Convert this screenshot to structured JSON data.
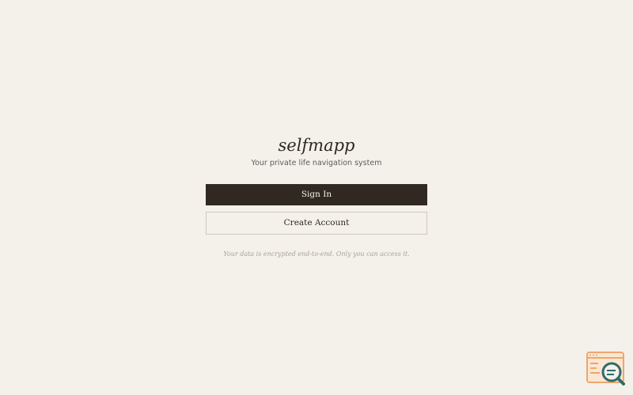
{
  "app": {
    "name": "selfmapp",
    "tagline": "Your private life navigation system"
  },
  "actions": {
    "sign_in_label": "Sign In",
    "create_account_label": "Create Account"
  },
  "footer": {
    "security_note": "Your data is encrypted end-to-end. Only you can access it."
  },
  "floating_widget": {
    "icon": "search-screen-icon"
  },
  "colors": {
    "background": "#f4f0ea",
    "primary_button": "#312921",
    "text_dark": "#2e2822",
    "muted": "#a8a29c",
    "widget_accent": "#eca76e",
    "widget_magnifier": "#2f6b6a"
  }
}
